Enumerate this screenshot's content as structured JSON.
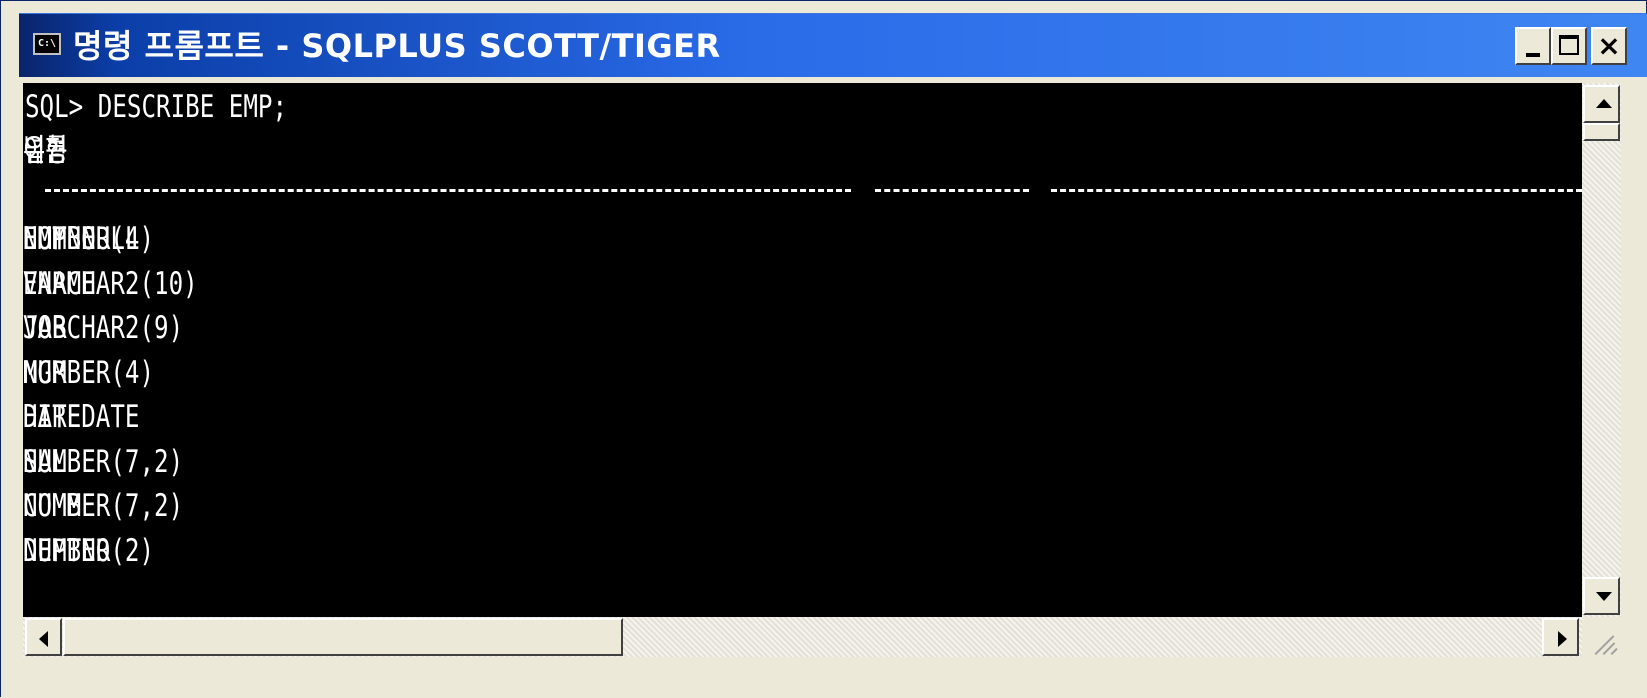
{
  "window": {
    "icon_label": "C:\\",
    "title": "명령 프롬프트 - SQLPLUS SCOTT/TIGER",
    "min_symbol": "",
    "close_symbol": "×"
  },
  "console": {
    "prompt_line": "SQL> DESCRIBE EMP;",
    "headers": {
      "name": "이름",
      "null": "널?",
      "type": "유형"
    },
    "rows": [
      {
        "name": "EMPNO",
        "null": "NOT NULL",
        "type": "NUMBER(4)"
      },
      {
        "name": "ENAME",
        "null": "",
        "type": "VARCHAR2(10)"
      },
      {
        "name": "JOB",
        "null": "",
        "type": "VARCHAR2(9)"
      },
      {
        "name": "MGR",
        "null": "",
        "type": "NUMBER(4)"
      },
      {
        "name": "HIREDATE",
        "null": "",
        "type": "DATE"
      },
      {
        "name": "SAL",
        "null": "",
        "type": "NUMBER(7,2)"
      },
      {
        "name": "COMM",
        "null": "",
        "type": "NUMBER(7,2)"
      },
      {
        "name": "DEPTNO",
        "null": "",
        "type": "NUMBER(2)"
      }
    ]
  },
  "colors": {
    "console_bg": "#000000",
    "console_fg": "#ffffff",
    "titlebar": "#2a6be8"
  }
}
